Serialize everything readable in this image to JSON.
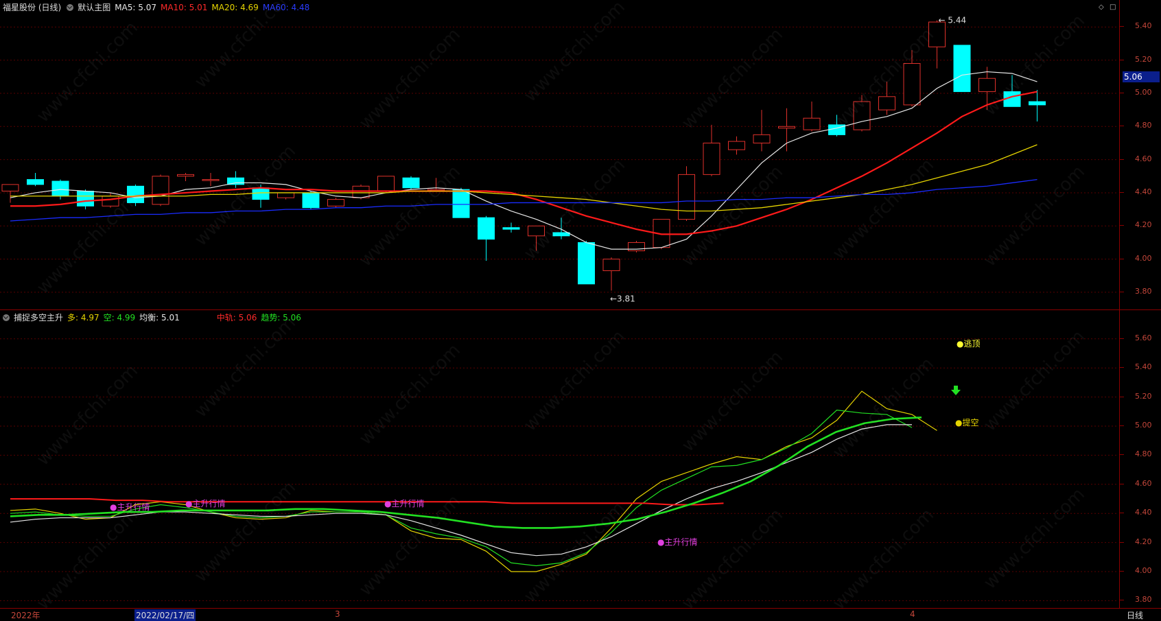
{
  "main_legend": {
    "title": "福星股份 (日线)",
    "template": "默认主图",
    "ma5": "MA5: 5.07",
    "ma10": "MA10: 5.01",
    "ma20": "MA20: 4.69",
    "ma60": "MA60: 4.48"
  },
  "sub_legend": {
    "name": "捕捉多空主升",
    "duo": "多: 4.97",
    "kong": "空: 4.99",
    "junheng": "均衡: 5.01",
    "zhonggui": "中轨: 5.06",
    "qushi": "趋势: 5.06"
  },
  "price_axis": [
    "5.40",
    "5.20",
    "5.00",
    "4.80",
    "4.60",
    "4.40",
    "4.20",
    "4.00",
    "3.80"
  ],
  "sub_axis": [
    "5.60",
    "5.40",
    "5.20",
    "5.00",
    "4.80",
    "4.60",
    "4.40",
    "4.20",
    "4.00",
    "3.80"
  ],
  "last_price": "5.06",
  "high_label": "5.44",
  "low_label": "3.81",
  "signals": {
    "zhusheng": "主升行情",
    "taoding": "逃顶",
    "tikong": "提空"
  },
  "date_bar": {
    "year": "2022年",
    "cursor": "2022/02/17/四",
    "march": "3",
    "april": "4",
    "period": "日线"
  },
  "watermark": "www.cfchi.com",
  "colors": {
    "up": "#e0312b",
    "down": "#00ffff",
    "ma5": "#e8e8e8",
    "ma10": "#ff1a1a",
    "ma20": "#e6d400",
    "ma60": "#1a2cff",
    "signal": "#e040e0",
    "ygreen": "#22e022"
  },
  "chart_data": [
    {
      "type": "candlestick",
      "title": "福星股份 (日线)",
      "ylim": [
        3.75,
        5.48
      ],
      "candles": [
        {
          "o": 4.41,
          "h": 4.45,
          "l": 4.34,
          "c": 4.45
        },
        {
          "o": 4.48,
          "h": 4.52,
          "l": 4.44,
          "c": 4.45
        },
        {
          "o": 4.47,
          "h": 4.48,
          "l": 4.36,
          "c": 4.38
        },
        {
          "o": 4.41,
          "h": 4.42,
          "l": 4.3,
          "c": 4.32
        },
        {
          "o": 4.32,
          "h": 4.4,
          "l": 4.31,
          "c": 4.38
        },
        {
          "o": 4.44,
          "h": 4.45,
          "l": 4.32,
          "c": 4.34
        },
        {
          "o": 4.33,
          "h": 4.51,
          "l": 4.32,
          "c": 4.5
        },
        {
          "o": 4.5,
          "h": 4.52,
          "l": 4.47,
          "c": 4.51
        },
        {
          "o": 4.48,
          "h": 4.52,
          "l": 4.44,
          "c": 4.48
        },
        {
          "o": 4.49,
          "h": 4.53,
          "l": 4.43,
          "c": 4.45
        },
        {
          "o": 4.43,
          "h": 4.45,
          "l": 4.31,
          "c": 4.36
        },
        {
          "o": 4.37,
          "h": 4.4,
          "l": 4.36,
          "c": 4.4
        },
        {
          "o": 4.4,
          "h": 4.41,
          "l": 4.3,
          "c": 4.31
        },
        {
          "o": 4.32,
          "h": 4.37,
          "l": 4.31,
          "c": 4.36
        },
        {
          "o": 4.37,
          "h": 4.45,
          "l": 4.36,
          "c": 4.44
        },
        {
          "o": 4.41,
          "h": 4.5,
          "l": 4.4,
          "c": 4.5
        },
        {
          "o": 4.49,
          "h": 4.5,
          "l": 4.42,
          "c": 4.43
        },
        {
          "o": 4.42,
          "h": 4.49,
          "l": 4.41,
          "c": 4.42
        },
        {
          "o": 4.42,
          "h": 4.43,
          "l": 4.25,
          "c": 4.25
        },
        {
          "o": 4.25,
          "h": 4.26,
          "l": 3.99,
          "c": 4.12
        },
        {
          "o": 4.19,
          "h": 4.22,
          "l": 4.16,
          "c": 4.18
        },
        {
          "o": 4.14,
          "h": 4.2,
          "l": 4.05,
          "c": 4.2
        },
        {
          "o": 4.16,
          "h": 4.25,
          "l": 4.12,
          "c": 4.14
        },
        {
          "o": 4.1,
          "h": 4.11,
          "l": 3.85,
          "c": 3.85
        },
        {
          "o": 3.93,
          "h": 4.01,
          "l": 3.81,
          "c": 4.0
        },
        {
          "o": 4.05,
          "h": 4.11,
          "l": 4.04,
          "c": 4.1
        },
        {
          "o": 4.07,
          "h": 4.24,
          "l": 4.06,
          "c": 4.24
        },
        {
          "o": 4.24,
          "h": 4.56,
          "l": 4.23,
          "c": 4.51
        },
        {
          "o": 4.51,
          "h": 4.81,
          "l": 4.5,
          "c": 4.7
        },
        {
          "o": 4.66,
          "h": 4.74,
          "l": 4.63,
          "c": 4.71
        },
        {
          "o": 4.7,
          "h": 4.9,
          "l": 4.65,
          "c": 4.75
        },
        {
          "o": 4.79,
          "h": 4.91,
          "l": 4.65,
          "c": 4.8
        },
        {
          "o": 4.78,
          "h": 4.95,
          "l": 4.77,
          "c": 4.85
        },
        {
          "o": 4.81,
          "h": 4.87,
          "l": 4.74,
          "c": 4.75
        },
        {
          "o": 4.78,
          "h": 4.99,
          "l": 4.77,
          "c": 4.95
        },
        {
          "o": 4.9,
          "h": 5.07,
          "l": 4.87,
          "c": 4.98
        },
        {
          "o": 4.93,
          "h": 5.26,
          "l": 4.92,
          "c": 5.18
        },
        {
          "o": 5.28,
          "h": 5.44,
          "l": 5.15,
          "c": 5.43
        },
        {
          "o": 5.29,
          "h": 5.29,
          "l": 5.01,
          "c": 5.01
        },
        {
          "o": 5.01,
          "h": 5.16,
          "l": 4.9,
          "c": 5.09
        },
        {
          "o": 5.01,
          "h": 5.11,
          "l": 4.92,
          "c": 4.92
        },
        {
          "o": 4.95,
          "h": 5.02,
          "l": 4.83,
          "c": 4.93
        }
      ],
      "series": [
        {
          "name": "MA5",
          "values": [
            4.37,
            4.4,
            4.42,
            4.41,
            4.4,
            4.37,
            4.38,
            4.42,
            4.43,
            4.46,
            4.46,
            4.45,
            4.41,
            4.38,
            4.37,
            4.4,
            4.42,
            4.43,
            4.42,
            4.35,
            4.29,
            4.24,
            4.18,
            4.1,
            4.06,
            4.06,
            4.07,
            4.12,
            4.26,
            4.42,
            4.58,
            4.7,
            4.76,
            4.79,
            4.83,
            4.86,
            4.91,
            5.03,
            5.11,
            5.13,
            5.12,
            5.07
          ]
        },
        {
          "name": "MA10",
          "values": [
            4.32,
            4.32,
            4.33,
            4.35,
            4.36,
            4.38,
            4.39,
            4.4,
            4.41,
            4.42,
            4.43,
            4.42,
            4.42,
            4.41,
            4.41,
            4.41,
            4.41,
            4.41,
            4.41,
            4.41,
            4.4,
            4.36,
            4.31,
            4.26,
            4.22,
            4.18,
            4.15,
            4.15,
            4.17,
            4.2,
            4.25,
            4.3,
            4.36,
            4.43,
            4.5,
            4.58,
            4.67,
            4.76,
            4.86,
            4.93,
            4.98,
            5.01
          ]
        },
        {
          "name": "MA20",
          "values": [
            4.38,
            4.38,
            4.38,
            4.38,
            4.38,
            4.38,
            4.38,
            4.38,
            4.39,
            4.39,
            4.4,
            4.4,
            4.4,
            4.4,
            4.4,
            4.4,
            4.41,
            4.41,
            4.41,
            4.4,
            4.39,
            4.38,
            4.37,
            4.36,
            4.34,
            4.32,
            4.3,
            4.29,
            4.29,
            4.3,
            4.31,
            4.33,
            4.35,
            4.37,
            4.39,
            4.42,
            4.45,
            4.49,
            4.53,
            4.57,
            4.63,
            4.69
          ]
        },
        {
          "name": "MA60",
          "values": [
            4.23,
            4.24,
            4.25,
            4.25,
            4.26,
            4.27,
            4.27,
            4.28,
            4.28,
            4.29,
            4.29,
            4.3,
            4.3,
            4.31,
            4.31,
            4.32,
            4.32,
            4.33,
            4.33,
            4.33,
            4.34,
            4.34,
            4.34,
            4.34,
            4.34,
            4.34,
            4.34,
            4.35,
            4.35,
            4.36,
            4.36,
            4.37,
            4.37,
            4.38,
            4.39,
            4.39,
            4.4,
            4.42,
            4.43,
            4.44,
            4.46,
            4.48
          ]
        }
      ]
    },
    {
      "type": "line",
      "title": "捕捉多空主升",
      "ylim": [
        3.75,
        5.75
      ],
      "series": [
        {
          "name": "多",
          "values": [
            4.42,
            4.43,
            4.4,
            4.36,
            4.37,
            4.46,
            4.48,
            4.46,
            4.41,
            4.37,
            4.36,
            4.37,
            4.42,
            4.41,
            4.41,
            4.39,
            4.28,
            4.23,
            4.22,
            4.14,
            4.0,
            4.0,
            4.05,
            4.12,
            4.3,
            4.5,
            4.62,
            4.68,
            4.74,
            4.79,
            4.77,
            4.86,
            4.92,
            5.04,
            5.24,
            5.12,
            5.08,
            4.97
          ]
        },
        {
          "name": "空",
          "values": [
            4.4,
            4.41,
            4.39,
            4.38,
            4.38,
            4.43,
            4.46,
            4.44,
            4.41,
            4.38,
            4.37,
            4.38,
            4.41,
            4.41,
            4.41,
            4.39,
            4.3,
            4.26,
            4.23,
            4.17,
            4.06,
            4.04,
            4.06,
            4.13,
            4.27,
            4.44,
            4.56,
            4.64,
            4.72,
            4.73,
            4.77,
            4.85,
            4.95,
            5.11,
            5.09,
            5.08,
            4.99
          ]
        },
        {
          "name": "均衡",
          "values": [
            4.34,
            4.36,
            4.37,
            4.37,
            4.37,
            4.39,
            4.41,
            4.41,
            4.4,
            4.39,
            4.38,
            4.38,
            4.39,
            4.4,
            4.4,
            4.39,
            4.35,
            4.3,
            4.25,
            4.19,
            4.13,
            4.11,
            4.12,
            4.17,
            4.24,
            4.33,
            4.42,
            4.5,
            4.57,
            4.62,
            4.68,
            4.75,
            4.82,
            4.91,
            4.98,
            5.01,
            5.01
          ]
        },
        {
          "name": "中轨",
          "values": [
            4.5,
            4.5,
            4.5,
            4.5,
            4.49,
            4.49,
            4.48,
            4.48,
            4.48,
            4.48,
            4.48,
            4.48,
            4.48,
            4.48,
            4.48,
            4.48,
            4.48,
            4.48,
            4.48,
            4.47,
            4.47,
            4.47,
            4.47,
            4.47,
            4.47,
            4.46,
            4.46,
            4.47,
            5.06
          ]
        },
        {
          "name": "趋势",
          "values": [
            4.38,
            4.39,
            4.39,
            4.4,
            4.41,
            4.41,
            4.42,
            4.42,
            4.42,
            4.42,
            4.43,
            4.43,
            4.42,
            4.41,
            4.39,
            4.37,
            4.34,
            4.31,
            4.3,
            4.3,
            4.31,
            4.33,
            4.36,
            4.41,
            4.47,
            4.54,
            4.62,
            4.73,
            4.86,
            4.96,
            5.02,
            5.05,
            5.06
          ]
        }
      ]
    }
  ]
}
